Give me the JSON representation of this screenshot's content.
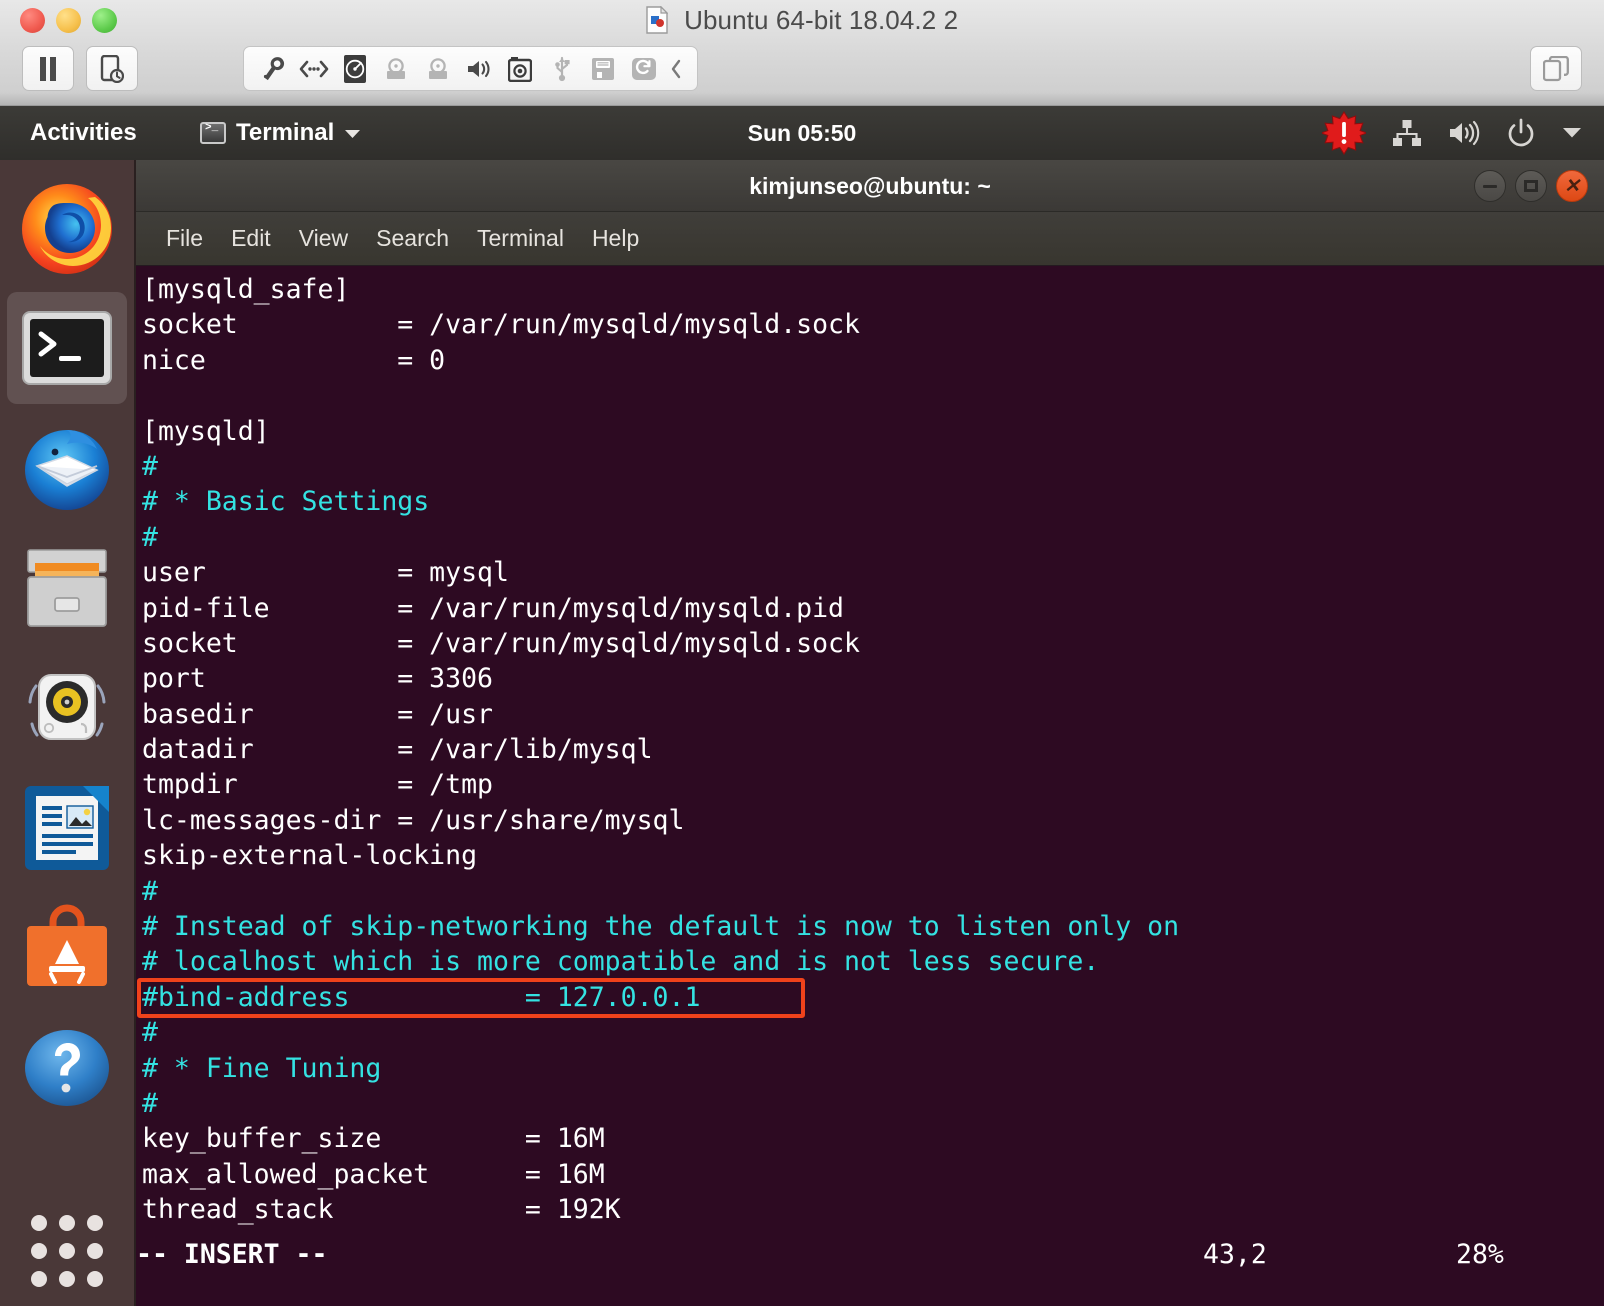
{
  "vm_window": {
    "title": "Ubuntu 64-bit 18.04.2 2",
    "traffic_lights": [
      "close-red",
      "minimize-yellow",
      "maximize-green"
    ],
    "toolbar_left": [
      "pause-icon",
      "snapshot-icon"
    ],
    "toolbar_icons": [
      "settings-wrench-icon",
      "network-adapter-icon",
      "hard-disk-icon",
      "cd-dvd-drive-icon",
      "cd-dvd-drive-2-icon",
      "sound-card-icon",
      "camera-icon",
      "usb-controller-icon",
      "floppy-drive-icon",
      "shared-folders-icon",
      "collapse-chevron-icon"
    ],
    "toolbar_right": "unity-view-icon"
  },
  "gnome_panel": {
    "activities": "Activities",
    "app_name": "Terminal",
    "app_icon": "terminal-icon",
    "app_menu_chevron": "chevron-down-icon",
    "clock": "Sun 05:50",
    "tray": [
      "alert-starburst-icon",
      "wired-network-icon",
      "volume-icon",
      "power-icon",
      "system-menu-chevron-icon"
    ]
  },
  "dock": {
    "items": [
      {
        "name": "firefox",
        "label": "Firefox Web Browser",
        "active": false
      },
      {
        "name": "terminal",
        "label": "Terminal",
        "active": true
      },
      {
        "name": "thunderbird",
        "label": "Thunderbird Mail",
        "active": false
      },
      {
        "name": "files",
        "label": "Files",
        "active": false
      },
      {
        "name": "rhythmbox",
        "label": "Rhythmbox",
        "active": false
      },
      {
        "name": "libreoffice-writer",
        "label": "LibreOffice Writer",
        "active": false
      },
      {
        "name": "ubuntu-software",
        "label": "Ubuntu Software",
        "active": false
      },
      {
        "name": "help",
        "label": "Help",
        "active": false
      }
    ],
    "show_applications": "Show Applications"
  },
  "terminal": {
    "title": "kimjunseo@ubuntu: ~",
    "menu": [
      "File",
      "Edit",
      "View",
      "Search",
      "Terminal",
      "Help"
    ],
    "window_controls": {
      "minimize": "minimize-button",
      "maximize": "maximize-button",
      "close": "close-button"
    },
    "lines": [
      {
        "text": "[mysqld_safe]",
        "color": "white"
      },
      {
        "text": "socket          = /var/run/mysqld/mysqld.sock",
        "color": "white"
      },
      {
        "text": "nice            = 0",
        "color": "white"
      },
      {
        "text": "",
        "color": "white"
      },
      {
        "text": "[mysqld]",
        "color": "white"
      },
      {
        "text": "#",
        "color": "cyan"
      },
      {
        "text": "# * Basic Settings",
        "color": "cyan"
      },
      {
        "text": "#",
        "color": "cyan"
      },
      {
        "text": "user            = mysql",
        "color": "white"
      },
      {
        "text": "pid-file        = /var/run/mysqld/mysqld.pid",
        "color": "white"
      },
      {
        "text": "socket          = /var/run/mysqld/mysqld.sock",
        "color": "white"
      },
      {
        "text": "port            = 3306",
        "color": "white"
      },
      {
        "text": "basedir         = /usr",
        "color": "white"
      },
      {
        "text": "datadir         = /var/lib/mysql",
        "color": "white"
      },
      {
        "text": "tmpdir          = /tmp",
        "color": "white"
      },
      {
        "text": "lc-messages-dir = /usr/share/mysql",
        "color": "white"
      },
      {
        "text": "skip-external-locking",
        "color": "white"
      },
      {
        "text": "#",
        "color": "cyan"
      },
      {
        "text": "# Instead of skip-networking the default is now to listen only on",
        "color": "cyan"
      },
      {
        "text": "# localhost which is more compatible and is not less secure.",
        "color": "cyan"
      },
      {
        "text": "#bind-address           = 127.0.0.1",
        "color": "cyan"
      },
      {
        "text": "#",
        "color": "cyan"
      },
      {
        "text": "# * Fine Tuning",
        "color": "cyan"
      },
      {
        "text": "#",
        "color": "cyan"
      },
      {
        "text": "key_buffer_size         = 16M",
        "color": "white"
      },
      {
        "text": "max_allowed_packet      = 16M",
        "color": "white"
      },
      {
        "text": "thread_stack            = 192K",
        "color": "white"
      }
    ],
    "status": {
      "mode": "-- INSERT --",
      "position": "43,2",
      "percent": "28%"
    },
    "highlight": {
      "target_line": "#bind-address           = 127.0.0.1",
      "color": "#f0421b"
    }
  },
  "colors": {
    "terminal_bg": "#2d0a22",
    "terminal_fg": "#ffffff",
    "terminal_comment": "#34e2e2",
    "dock_bg": "#4a3838",
    "panel_bg": "#3c3b37",
    "accent_close": "#dd4814",
    "highlight_red": "#f0421b"
  }
}
